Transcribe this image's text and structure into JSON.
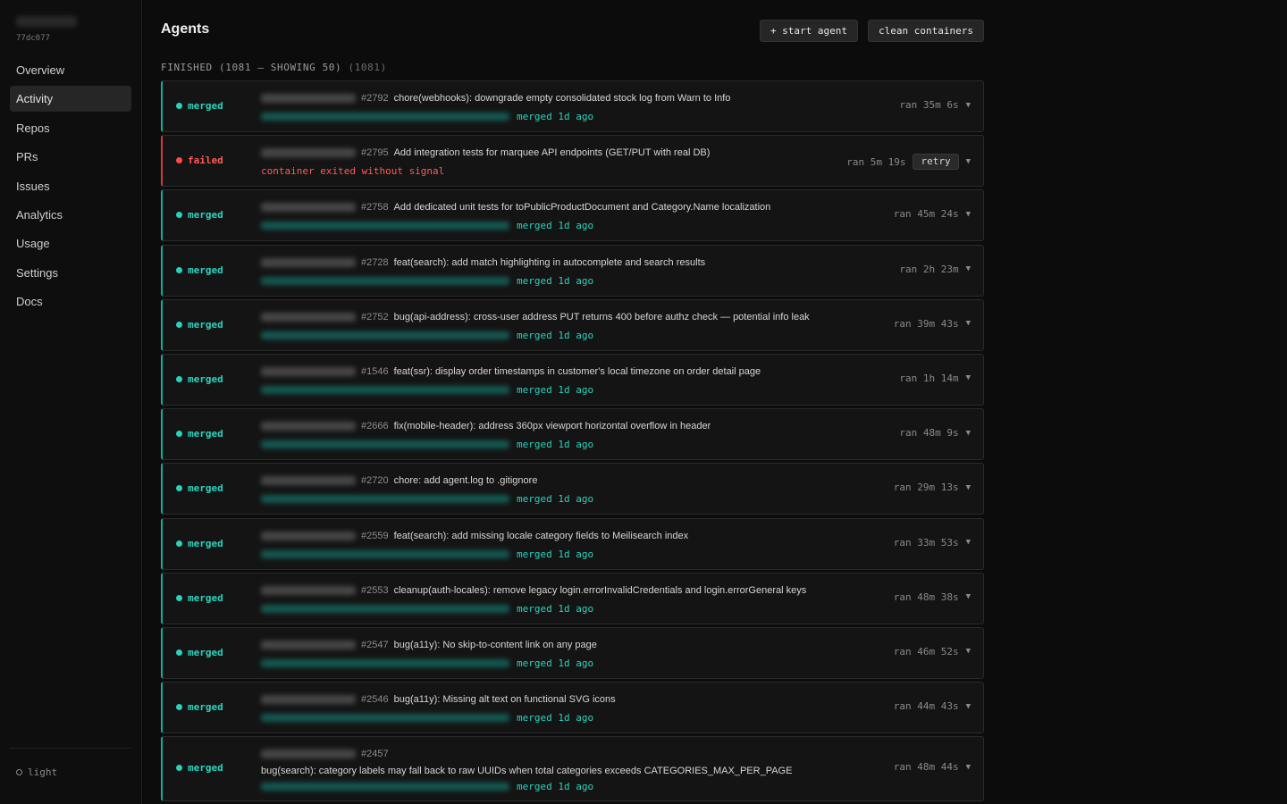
{
  "sidebar": {
    "build_id": "77dc077",
    "nav": [
      {
        "label": "Overview",
        "active": false
      },
      {
        "label": "Activity",
        "active": true
      },
      {
        "label": "Repos",
        "active": false
      },
      {
        "label": "PRs",
        "active": false
      },
      {
        "label": "Issues",
        "active": false
      },
      {
        "label": "Analytics",
        "active": false
      },
      {
        "label": "Usage",
        "active": false
      },
      {
        "label": "Settings",
        "active": false
      },
      {
        "label": "Docs",
        "active": false
      }
    ],
    "theme_label": "light"
  },
  "header": {
    "title": "Agents",
    "start_button": "+ start agent",
    "clean_button": "clean containers"
  },
  "section": {
    "label": "FINISHED (1081 — SHOWING 50)",
    "count": "(1081)"
  },
  "colors": {
    "merged": "#2ad2be",
    "failed": "#ff5a5a",
    "accent_border": "#17a99c"
  },
  "agents": [
    {
      "status": "merged",
      "number": "#2792",
      "title": "chore(webhooks): downgrade empty consolidated stock log from Warn to Info",
      "detail": "merged 1d ago",
      "duration": "ran 35m 6s"
    },
    {
      "status": "failed",
      "number": "#2795",
      "title": "Add integration tests for marquee API endpoints (GET/PUT with real DB)",
      "detail": "container exited without signal",
      "duration": "ran 5m 19s",
      "action": "retry"
    },
    {
      "status": "merged",
      "number": "#2758",
      "title": "Add dedicated unit tests for toPublicProductDocument and Category.Name localization",
      "detail": "merged 1d ago",
      "duration": "ran 45m 24s"
    },
    {
      "status": "merged",
      "number": "#2728",
      "title": "feat(search): add match highlighting in autocomplete and search results",
      "detail": "merged 1d ago",
      "duration": "ran 2h 23m"
    },
    {
      "status": "merged",
      "number": "#2752",
      "title": "bug(api-address): cross-user address PUT returns 400 before authz check — potential info leak",
      "detail": "merged 1d ago",
      "duration": "ran 39m 43s"
    },
    {
      "status": "merged",
      "number": "#1546",
      "title": "feat(ssr): display order timestamps in customer's local timezone on order detail page",
      "detail": "merged 1d ago",
      "duration": "ran 1h 14m"
    },
    {
      "status": "merged",
      "number": "#2666",
      "title": "fix(mobile-header): address 360px viewport horizontal overflow in header",
      "detail": "merged 1d ago",
      "duration": "ran 48m 9s"
    },
    {
      "status": "merged",
      "number": "#2720",
      "title": "chore: add agent.log to .gitignore",
      "detail": "merged 1d ago",
      "duration": "ran 29m 13s"
    },
    {
      "status": "merged",
      "number": "#2559",
      "title": "feat(search): add missing locale category fields to Meilisearch index",
      "detail": "merged 1d ago",
      "duration": "ran 33m 53s"
    },
    {
      "status": "merged",
      "number": "#2553",
      "title": "cleanup(auth-locales): remove legacy login.errorInvalidCredentials and login.errorGeneral keys",
      "detail": "merged 1d ago",
      "duration": "ran 48m 38s"
    },
    {
      "status": "merged",
      "number": "#2547",
      "title": "bug(a11y): No skip-to-content link on any page",
      "detail": "merged 1d ago",
      "duration": "ran 46m 52s"
    },
    {
      "status": "merged",
      "number": "#2546",
      "title": "bug(a11y): Missing alt text on functional SVG icons",
      "detail": "merged 1d ago",
      "duration": "ran 44m 43s"
    },
    {
      "status": "merged",
      "number": "#2457",
      "title": "bug(search): category labels may fall back to raw UUIDs when total categories exceeds CATEGORIES_MAX_PER_PAGE",
      "detail": "merged 1d ago",
      "duration": "ran 48m 44s",
      "wrap": true
    }
  ]
}
